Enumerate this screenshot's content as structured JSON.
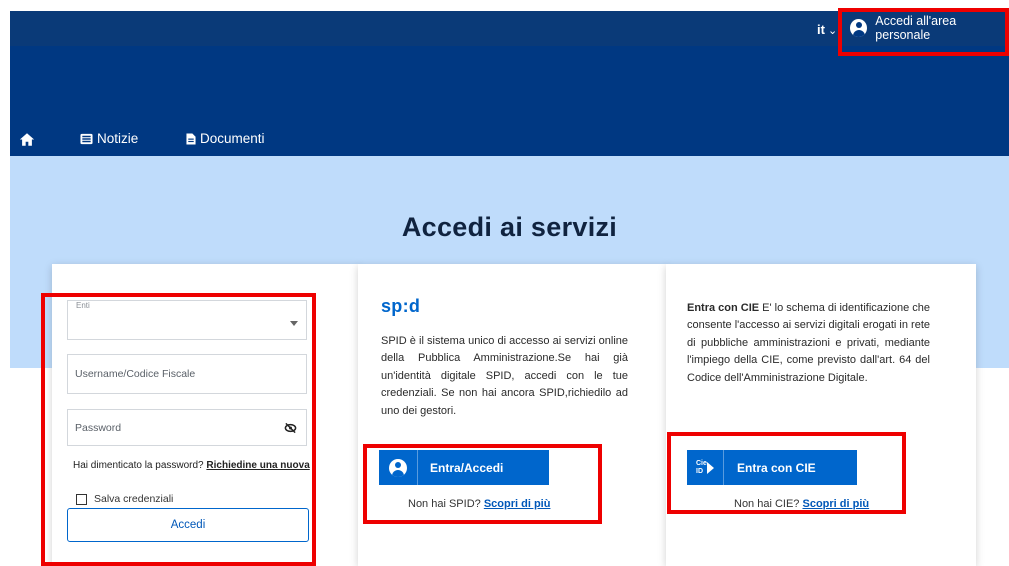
{
  "topbar": {
    "lang": "it",
    "personal_area": "Accedi all'area personale"
  },
  "nav": {
    "items": [
      {
        "label": "Notizie",
        "icon": "newspaper-icon"
      },
      {
        "label": "Documenti",
        "icon": "document-icon"
      }
    ]
  },
  "main": {
    "title": "Accedi ai servizi"
  },
  "login": {
    "enti_label": "Enti",
    "username_placeholder": "Username/Codice Fiscale",
    "password_placeholder": "Password",
    "forgot_text": "Hai dimenticato la password?",
    "forgot_link": "Richiedine una nuova",
    "remember_label": "Salva credenziali",
    "submit_label": "Accedi"
  },
  "spid": {
    "logo": "sp:d",
    "description": "SPID è il sistema unico di accesso ai servizi online della Pubblica Amministrazione.Se hai già un'identità digitale SPID, accedi con le tue credenziali. Se non hai ancora SPID,richiedilo ad uno dei gestori.",
    "button_label": "Entra/Accedi",
    "no_account_text": "Non hai SPID?",
    "discover_link": "Scopri di più"
  },
  "cie": {
    "lead": "Entra con CIE",
    "description": " E' lo schema di identificazione che consente l'accesso ai servizi digitali erogati in rete di pubbliche amministrazioni e privati, mediante l'impiego della CIE, come previsto dall'art. 64 del Codice dell'Amministrazione Digitale.",
    "button_label": "Entra con CIE",
    "icon_text": "Cie ID",
    "no_account_text": "Non hai CIE?",
    "discover_link": "Scopri di più"
  },
  "colors": {
    "header": "#003882",
    "topbar": "#0a3a78",
    "band": "#bfdcfb",
    "accent": "#0066cc",
    "highlight": "#ee0000"
  }
}
